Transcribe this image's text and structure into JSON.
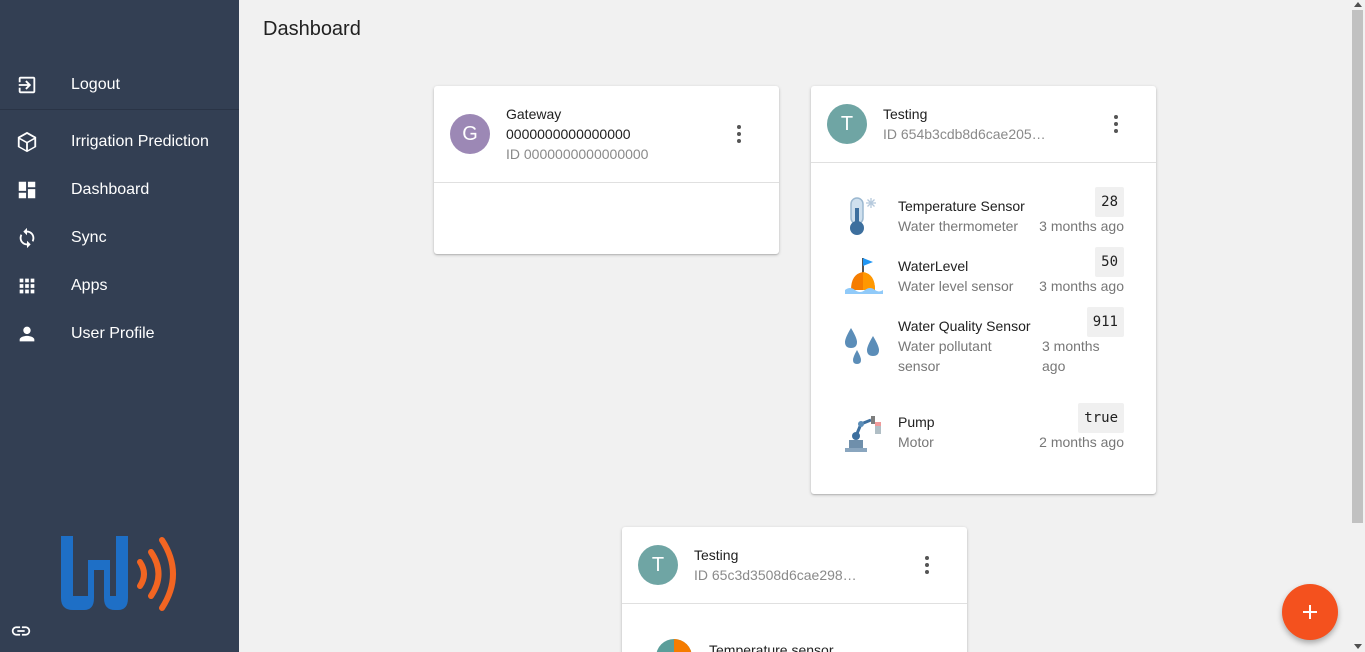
{
  "sidebar": {
    "items": [
      {
        "label": "Logout",
        "icon": "logout-icon"
      },
      {
        "label": "Irrigation Prediction",
        "icon": "cube-icon"
      },
      {
        "label": "Dashboard",
        "icon": "dashboard-icon"
      },
      {
        "label": "Sync",
        "icon": "sync-icon"
      },
      {
        "label": "Apps",
        "icon": "apps-grid-icon"
      },
      {
        "label": "User Profile",
        "icon": "person-icon"
      }
    ],
    "logo_letter": "W",
    "footer_icon": "link-icon"
  },
  "page": {
    "title": "Dashboard"
  },
  "gateway_card": {
    "avatar": "G",
    "avatar_color": "#9c88b5",
    "title": "Gateway",
    "subtitle1": "0000000000000000",
    "subtitle2": "ID 0000000000000000"
  },
  "testing_card_1": {
    "avatar": "T",
    "avatar_color": "#6fa5a4",
    "title": "Testing",
    "subtitle": "ID 654b3cdb8d6cae205…",
    "sensors": [
      {
        "name": "Temperature Sensor",
        "type": "Water thermometer",
        "value": "28",
        "time": "3 months ago",
        "icon": "thermometer-icon"
      },
      {
        "name": "WaterLevel",
        "type": "Water level sensor",
        "value": "50",
        "time": "3 months ago",
        "icon": "buoy-icon"
      },
      {
        "name": "Water Quality Sensor",
        "type": "Water pollutant sensor",
        "value": "911",
        "time": "3 months ago",
        "icon": "water-drops-icon"
      },
      {
        "name": "Pump",
        "type": "Motor",
        "value": "true",
        "time": "2 months ago",
        "icon": "robot-arm-icon"
      }
    ]
  },
  "testing_card_2": {
    "avatar": "T",
    "avatar_color": "#6fa5a4",
    "title": "Testing",
    "subtitle": "ID 65c3d3508d6cae298…",
    "first_sensor_name": "Temperature sensor"
  },
  "fab": {
    "icon": "plus-icon",
    "color": "#f4511e"
  },
  "colors": {
    "sidebar": "#333f53",
    "background": "#f1f1f1",
    "accent": "#f4511e",
    "logo_blue": "#1e6fc6",
    "logo_orange": "#f26522"
  }
}
